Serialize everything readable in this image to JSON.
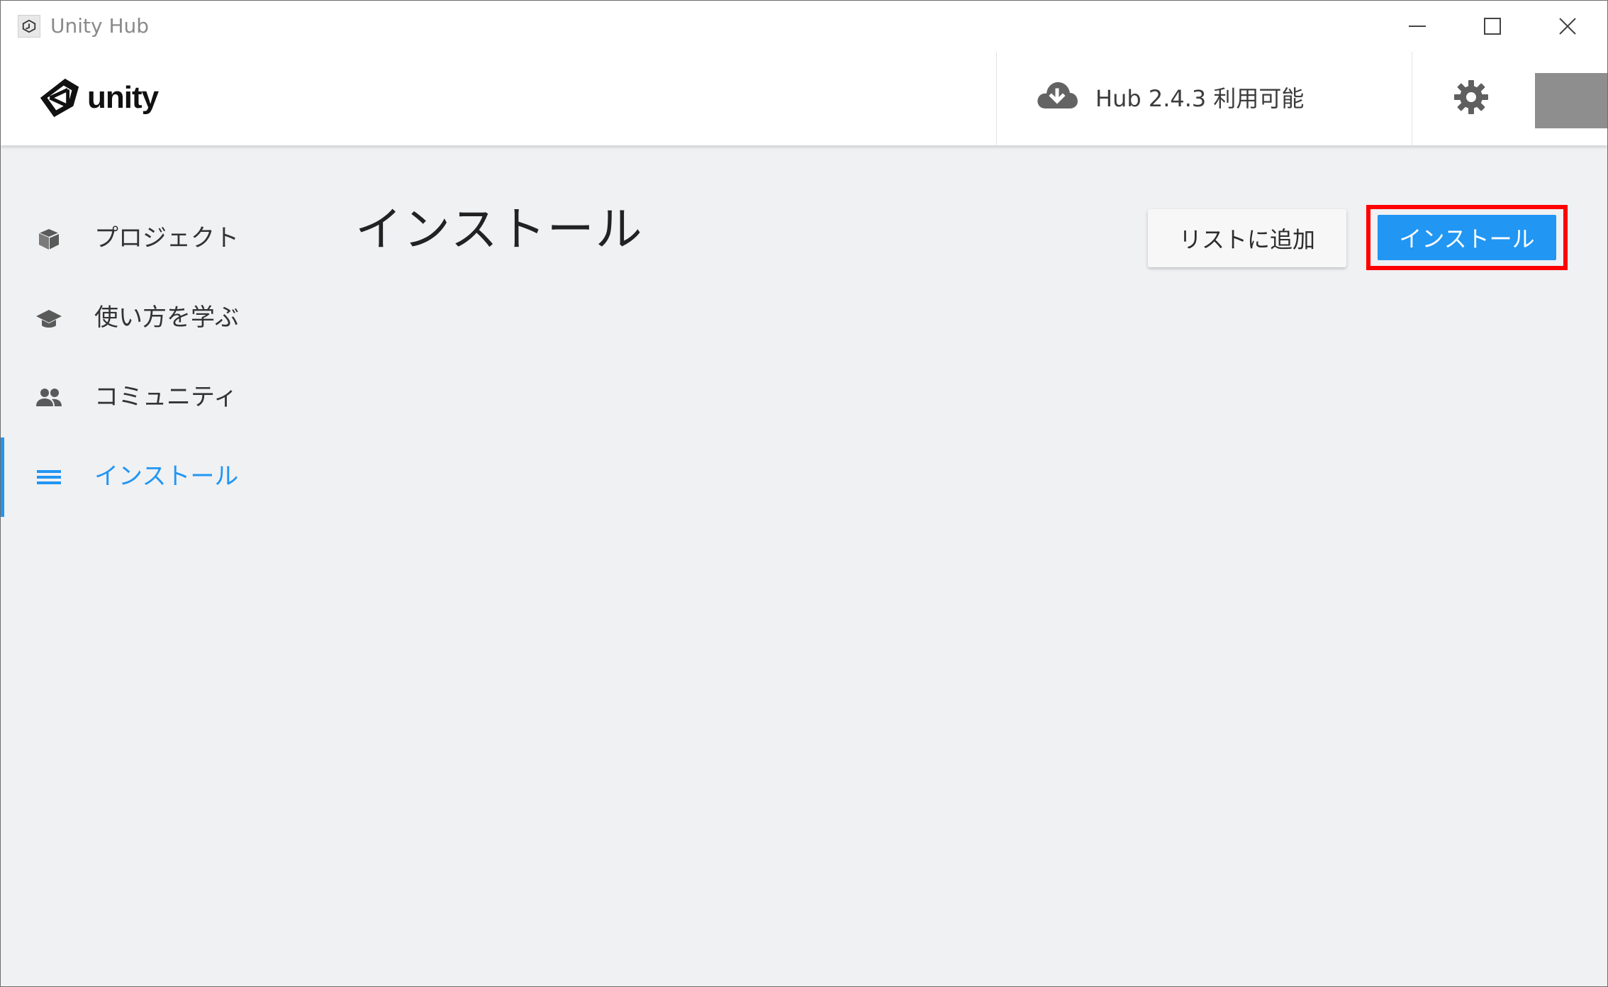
{
  "window": {
    "title": "Unity Hub"
  },
  "header": {
    "logo_text": "unity",
    "update_text": "Hub 2.4.3 利用可能"
  },
  "sidebar": {
    "items": [
      {
        "label": "プロジェクト",
        "icon": "cube-icon",
        "active": false
      },
      {
        "label": "使い方を学ぶ",
        "icon": "graduation-cap-icon",
        "active": false
      },
      {
        "label": "コミュニティ",
        "icon": "people-icon",
        "active": false
      },
      {
        "label": "インストール",
        "icon": "list-icon",
        "active": true
      }
    ]
  },
  "main": {
    "title": "インストール",
    "add_to_list_label": "リストに追加",
    "install_label": "インストール"
  },
  "colors": {
    "accent": "#2196f3",
    "highlight_border": "#ff0000",
    "background": "#f0f1f3",
    "avatar": "#8e8e8e"
  }
}
